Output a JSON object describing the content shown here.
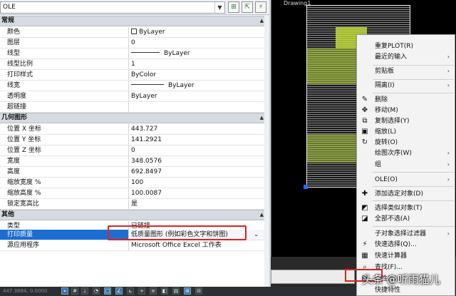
{
  "object_selector": {
    "value": "OLE"
  },
  "drawing": {
    "doc_name": "Drawing1"
  },
  "sections": {
    "general": "常规",
    "geometry": "几何图形",
    "misc": "其他"
  },
  "general_rows": [
    {
      "label": "颜色",
      "value": "ByLayer"
    },
    {
      "label": "图层",
      "value": "0"
    },
    {
      "label": "线型",
      "value": "ByLayer"
    },
    {
      "label": "线型比例",
      "value": "1"
    },
    {
      "label": "打印样式",
      "value": "ByColor"
    },
    {
      "label": "线宽",
      "value": "ByLayer"
    },
    {
      "label": "透明度",
      "value": "ByLayer"
    },
    {
      "label": "超链接",
      "value": ""
    }
  ],
  "geometry_rows": [
    {
      "label": "位置 X 坐标",
      "value": "443.727"
    },
    {
      "label": "位置 Y 坐标",
      "value": "141.2921"
    },
    {
      "label": "位置 Z 坐标",
      "value": "0"
    },
    {
      "label": "宽度",
      "value": "348.0576"
    },
    {
      "label": "高度",
      "value": "692.8497"
    },
    {
      "label": "缩放宽度 %",
      "value": "100"
    },
    {
      "label": "缩放高度 %",
      "value": "100.0087"
    },
    {
      "label": "锁定宽高比",
      "value": "是"
    }
  ],
  "misc_rows": [
    {
      "label": "类型",
      "value": "已链接"
    },
    {
      "label": "打印质量",
      "value": "低质量图形 (例如彩色文字和饼图)"
    },
    {
      "label": "源应用程序",
      "value": "Microsoft Office Excel 工作表"
    }
  ],
  "status": {
    "coords": "447.3884, 0.0000"
  },
  "context_menu": [
    {
      "label": "重复PLOT(R)",
      "icon": ""
    },
    {
      "label": "最近的输入",
      "icon": "",
      "submenu": true
    },
    {
      "label": "剪贴板",
      "icon": "",
      "submenu": true
    },
    {
      "label": "隔离(I)",
      "icon": "",
      "submenu": true
    },
    {
      "label": "删除",
      "icon": "✎"
    },
    {
      "label": "移动(M)",
      "icon": "✥"
    },
    {
      "label": "复制选择(Y)",
      "icon": "⧉"
    },
    {
      "label": "缩放(L)",
      "icon": "▣"
    },
    {
      "label": "旋转(O)",
      "icon": "↻"
    },
    {
      "label": "绘图次序(W)",
      "icon": "",
      "submenu": true
    },
    {
      "label": "组",
      "icon": "",
      "submenu": true
    },
    {
      "label": "OLE(O)",
      "icon": "",
      "submenu": true
    },
    {
      "label": "添加选定对象(D)",
      "icon": "✚"
    },
    {
      "label": "选择类似对象(T)",
      "icon": "◩"
    },
    {
      "label": "全部不选(A)",
      "icon": "◪"
    },
    {
      "label": "子对象选择过滤器",
      "icon": "",
      "submenu": true
    },
    {
      "label": "快速选择(Q)...",
      "icon": "⚡"
    },
    {
      "label": "快速计算器",
      "icon": "▦"
    },
    {
      "label": "查找(F)...",
      "icon": "⌕"
    },
    {
      "label": "特性(S)",
      "icon": "▤"
    },
    {
      "label": "快捷特性",
      "icon": ""
    }
  ],
  "watermark": "头条 @听雨猫儿"
}
